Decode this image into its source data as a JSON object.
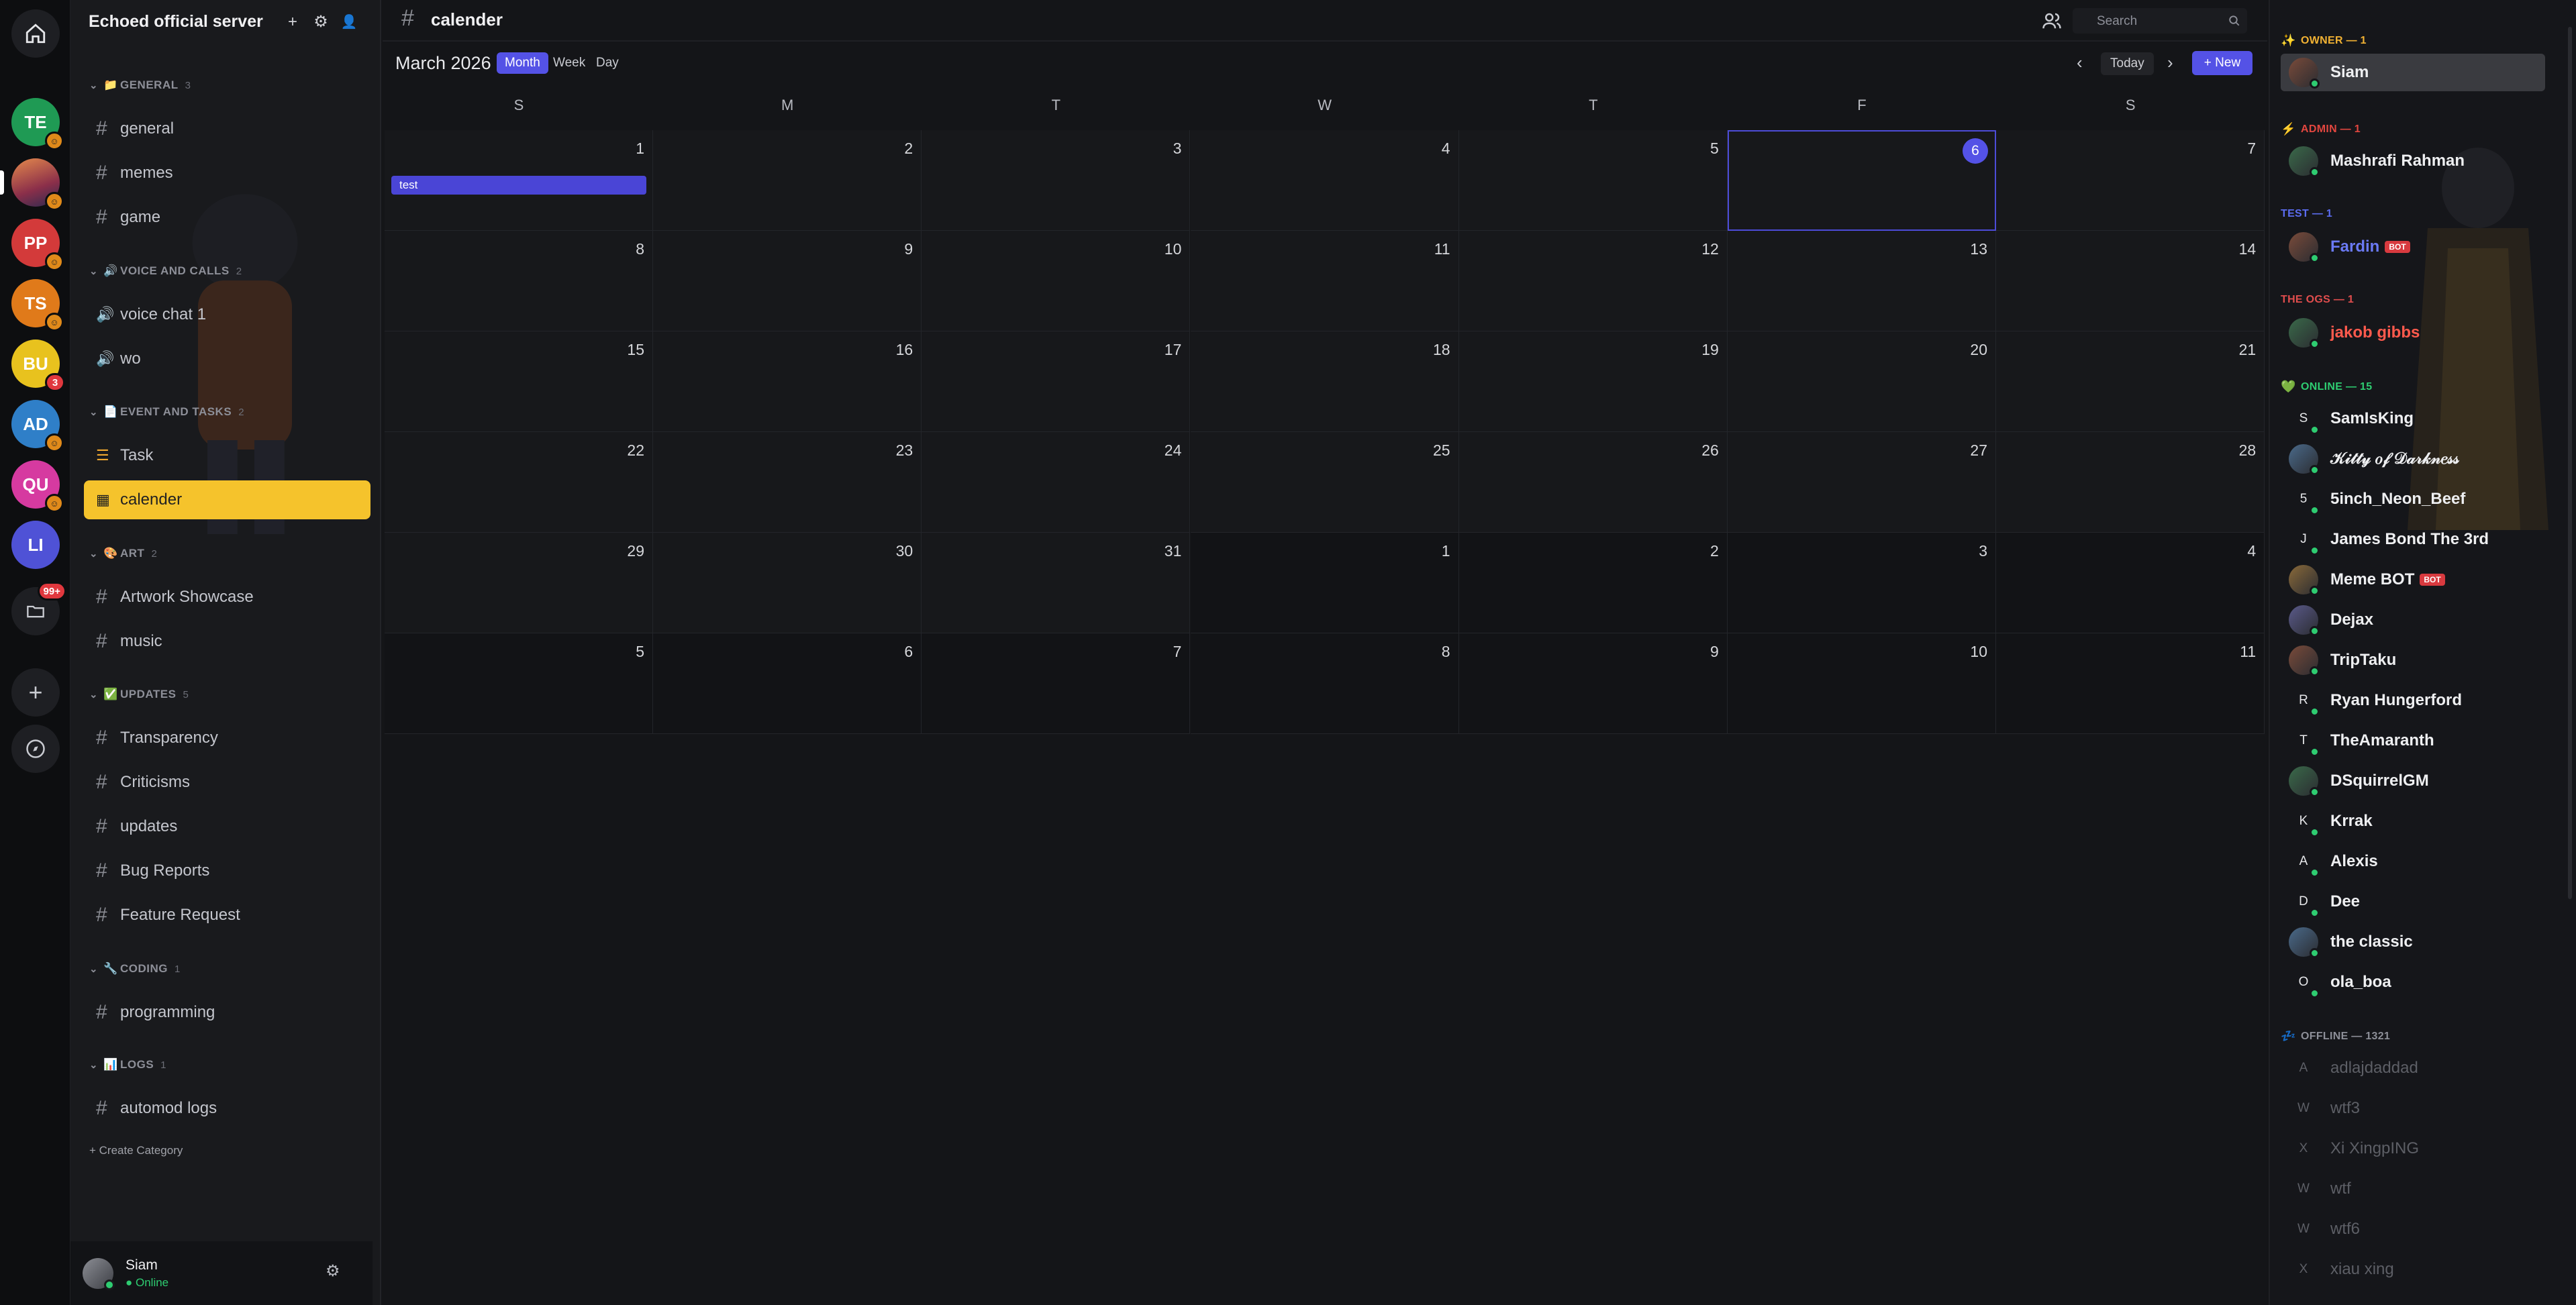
{
  "server": {
    "name": "Echoed official server"
  },
  "rail": {
    "servers": [
      {
        "label": "TE",
        "color": "#1f9a54",
        "badge": "emoji"
      },
      {
        "label": "",
        "color": "#b94a3a",
        "badge": "emoji"
      },
      {
        "label": "PP",
        "color": "#d33a3a",
        "badge": "emoji"
      },
      {
        "label": "TS",
        "color": "#e07a1a",
        "badge": "emoji"
      },
      {
        "label": "BU",
        "color": "#e8c21e",
        "badge": "3"
      },
      {
        "label": "AD",
        "color": "#2f7fc8",
        "badge": "emoji"
      },
      {
        "label": "QU",
        "color": "#d63aa0",
        "badge": "emoji"
      },
      {
        "label": "LI",
        "color": "#4f52d6",
        "badge": ""
      }
    ],
    "folder_badge": "99+"
  },
  "sidebar": {
    "categories": [
      {
        "name": "GENERAL",
        "count": "3",
        "icon": "folder-icon",
        "channels": [
          {
            "name": "general",
            "type": "text"
          },
          {
            "name": "memes",
            "type": "text"
          },
          {
            "name": "game",
            "type": "text"
          }
        ]
      },
      {
        "name": "VOICE AND CALLS",
        "count": "2",
        "icon": "speaker-icon",
        "channels": [
          {
            "name": "voice chat 1",
            "type": "voice"
          },
          {
            "name": "wo",
            "type": "voice"
          }
        ]
      },
      {
        "name": "EVENT AND TASKS",
        "count": "2",
        "icon": "page-icon",
        "channels": [
          {
            "name": "Task",
            "type": "task"
          },
          {
            "name": "calender",
            "type": "calendar"
          }
        ]
      },
      {
        "name": "ART",
        "count": "2",
        "icon": "palette-icon",
        "channels": [
          {
            "name": "Artwork Showcase",
            "type": "text"
          },
          {
            "name": "music",
            "type": "text"
          }
        ]
      },
      {
        "name": "UPDATES",
        "count": "5",
        "icon": "check-box-icon",
        "channels": [
          {
            "name": "Transparency",
            "type": "text"
          },
          {
            "name": "Criticisms",
            "type": "text"
          },
          {
            "name": "updates",
            "type": "text"
          },
          {
            "name": "Bug Reports",
            "type": "text"
          },
          {
            "name": "Feature Request",
            "type": "text"
          }
        ]
      },
      {
        "name": "CODING",
        "count": "1",
        "icon": "wrench-icon",
        "channels": [
          {
            "name": "programming",
            "type": "text"
          }
        ]
      },
      {
        "name": "LOGS",
        "count": "1",
        "icon": "chart-icon",
        "channels": [
          {
            "name": "automod logs",
            "type": "text"
          }
        ]
      }
    ],
    "create_category": "+ Create Category"
  },
  "user": {
    "name": "Siam",
    "status": "● Online"
  },
  "channel": {
    "title": "calender"
  },
  "search": {
    "placeholder": "Search"
  },
  "calendar": {
    "month": "March 2026",
    "views": [
      "Month",
      "Week",
      "Day"
    ],
    "active_view": "Month",
    "today_label": "Today",
    "new_label": "+ New",
    "weekdays": [
      "S",
      "M",
      "T",
      "W",
      "T",
      "F",
      "S"
    ],
    "weeks": [
      [
        "1",
        "2",
        "3",
        "4",
        "5",
        "6",
        "7"
      ],
      [
        "8",
        "9",
        "10",
        "11",
        "12",
        "13",
        "14"
      ],
      [
        "15",
        "16",
        "17",
        "18",
        "19",
        "20",
        "21"
      ],
      [
        "22",
        "23",
        "24",
        "25",
        "26",
        "27",
        "28"
      ],
      [
        "29",
        "30",
        "31",
        "1",
        "2",
        "3",
        "4"
      ],
      [
        "5",
        "6",
        "7",
        "8",
        "9",
        "10",
        "11"
      ]
    ],
    "today": "6",
    "events": [
      {
        "day": "1",
        "title": "test"
      }
    ]
  },
  "members": {
    "groups": [
      {
        "label": "OWNER — 1",
        "icon": "✨",
        "color": "#f2b233",
        "members": [
          {
            "name": "Siam",
            "avatar": "img",
            "selected": true
          }
        ]
      },
      {
        "label": "ADMIN — 1",
        "icon": "⚡",
        "color": "#e2463f",
        "members": [
          {
            "name": "Mashrafi Rahman",
            "avatar": "img"
          }
        ]
      },
      {
        "label": "TEST — 1",
        "icon": "",
        "color": "#5b6cf0",
        "members": [
          {
            "name": "Fardin",
            "avatar": "img",
            "bot": "BOT",
            "name_color": "#6b7af5"
          }
        ]
      },
      {
        "label": "THE OGS — 1",
        "icon": "",
        "color": "#e04d4d",
        "members": [
          {
            "name": "jakob gibbs",
            "avatar": "img",
            "name_color": "#ff5a4d"
          }
        ]
      },
      {
        "label": "ONLINE — 15",
        "icon": "💚",
        "color": "#2ecc71",
        "members": [
          {
            "name": "SamIsKing",
            "avatar": "S"
          },
          {
            "name": "𝒦𝒾𝓉𝓉𝓎 𝑜𝒻 𝒟𝒶𝓇𝓀𝓃𝑒𝓈𝓈",
            "avatar": "img"
          },
          {
            "name": "5inch_Neon_Beef",
            "avatar": "5"
          },
          {
            "name": "James Bond The 3rd",
            "avatar": "J"
          },
          {
            "name": "Meme BOT",
            "avatar": "img",
            "bot": "BOT"
          },
          {
            "name": "Dejax",
            "avatar": "img"
          },
          {
            "name": "TripTaku",
            "avatar": "img"
          },
          {
            "name": "Ryan Hungerford",
            "avatar": "R"
          },
          {
            "name": "TheAmaranth",
            "avatar": "T"
          },
          {
            "name": "DSquirrelGM",
            "avatar": "img"
          },
          {
            "name": "Krrak",
            "avatar": "K"
          },
          {
            "name": "Alexis",
            "avatar": "A"
          },
          {
            "name": "Dee",
            "avatar": "D"
          },
          {
            "name": "the classic",
            "avatar": "img"
          },
          {
            "name": "ola_boa",
            "avatar": "O"
          }
        ]
      },
      {
        "label": "OFFLINE — 1321",
        "icon": "💤",
        "color": "#8d8f98",
        "members": [
          {
            "name": "adlajdaddad",
            "avatar": "A",
            "offline": true
          },
          {
            "name": "wtf3",
            "avatar": "W",
            "offline": true
          },
          {
            "name": "Xi XingpING",
            "avatar": "X",
            "offline": true
          },
          {
            "name": "wtf",
            "avatar": "W",
            "offline": true
          },
          {
            "name": "wtf6",
            "avatar": "W",
            "offline": true
          },
          {
            "name": "xiau xing",
            "avatar": "X",
            "offline": true
          }
        ]
      }
    ]
  },
  "colors": {
    "accent": "#5452e6",
    "active_channel": "#f5c32c",
    "online": "#2ecc71"
  }
}
